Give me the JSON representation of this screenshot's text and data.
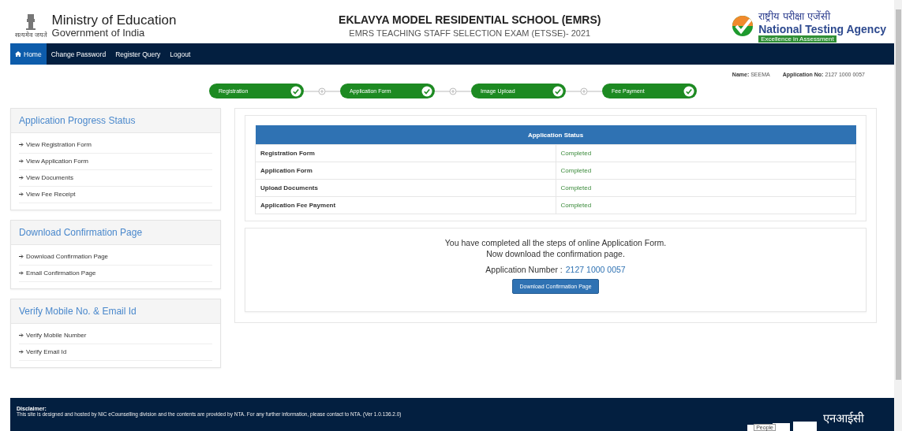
{
  "header": {
    "ministry": "Ministry of Education",
    "government": "Government of India",
    "emblem_caption": "सत्यमेव जयते",
    "title": "EKLAVYA MODEL RESIDENTIAL SCHOOL (EMRS)",
    "subtitle": "EMRS TEACHING STAFF SELECTION EXAM (ETSSE)- 2021",
    "agency_hindi": "राष्ट्रीय परीक्षा एजेंसी",
    "agency": "National Testing Agency",
    "agency_tagline": "Excellence in Assessment"
  },
  "nav": [
    {
      "label": "Home",
      "selected": true,
      "kind": "home"
    },
    {
      "label": "Change Password",
      "selected": false,
      "kind": "link"
    },
    {
      "label": "Register Query",
      "selected": false,
      "kind": "link"
    },
    {
      "label": "Logout",
      "selected": false,
      "kind": "link"
    }
  ],
  "candidate": {
    "name_label": "Name:",
    "name": "SEEMA",
    "app_label": "Application No:",
    "app_no": "2127 1000 0057"
  },
  "steps": [
    {
      "label": "Registration",
      "completed": true
    },
    {
      "label": "Application Form",
      "completed": true
    },
    {
      "label": "Image Upload",
      "completed": true
    },
    {
      "label": "Fee Payment",
      "completed": true
    }
  ],
  "sidebar": [
    {
      "title": "Application Progress Status",
      "items": [
        "View Registration Form",
        "View Application Form",
        "View Documents",
        "View Fee Receipt"
      ]
    },
    {
      "title": "Download Confirmation Page",
      "items": [
        "Download Confirmation Page",
        "Email Confirmation Page"
      ]
    },
    {
      "title": "Verify Mobile No. & Email Id",
      "items": [
        "Verify Mobile Number",
        "Verify Email Id"
      ]
    }
  ],
  "status_table": {
    "heading": "Application Status",
    "rows": [
      {
        "item": "Registration Form",
        "status": "Completed"
      },
      {
        "item": "Application Form",
        "status": "Completed"
      },
      {
        "item": "Upload Documents",
        "status": "Completed"
      },
      {
        "item": "Application Fee Payment",
        "status": "Completed"
      }
    ]
  },
  "completion": {
    "line_1": "You have completed all the steps of online Application Form.",
    "line_2": "Now download the confirmation page.",
    "number_label": "Application Number :",
    "number": "2127 1000 0057",
    "button": "Download Confirmation Page"
  },
  "footer": {
    "title": "Disclaimer:",
    "text": "This site is designed and hosted by NIC eCounselling division and the contents are provided by NTA. For any further information, please contact to NTA. (Ver 1.0.136.2.0)",
    "logo_hindi": "एनआईसी",
    "tooltip": "People"
  }
}
